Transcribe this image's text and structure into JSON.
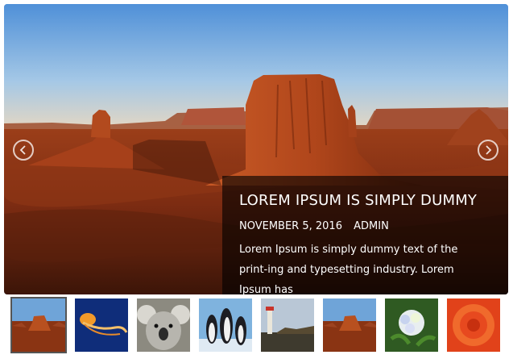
{
  "slider": {
    "prev_icon": "chevron-left-icon",
    "next_icon": "chevron-right-icon",
    "caption": {
      "title": "LOREM IPSUM IS SIMPLY DUMMY",
      "date": "NOVEMBER 5, 2016",
      "author": "ADMIN",
      "text": "Lorem Ipsum is simply dummy text of the print-ing and typesetting industry. Lorem Ipsum has"
    }
  },
  "thumbnails": [
    {
      "subject": "desert-mesa",
      "active": true
    },
    {
      "subject": "jellyfish",
      "active": false
    },
    {
      "subject": "koala",
      "active": false
    },
    {
      "subject": "penguins",
      "active": false
    },
    {
      "subject": "lighthouse",
      "active": false
    },
    {
      "subject": "desert-mesa",
      "active": false
    },
    {
      "subject": "hydrangea",
      "active": false
    },
    {
      "subject": "chrysanthemum",
      "active": false
    }
  ],
  "colors": {
    "caption_bg": "rgba(0,0,0,0.62)",
    "active_border": "#555555",
    "sky": "#6aa6dd",
    "rock": "#b2451c"
  }
}
